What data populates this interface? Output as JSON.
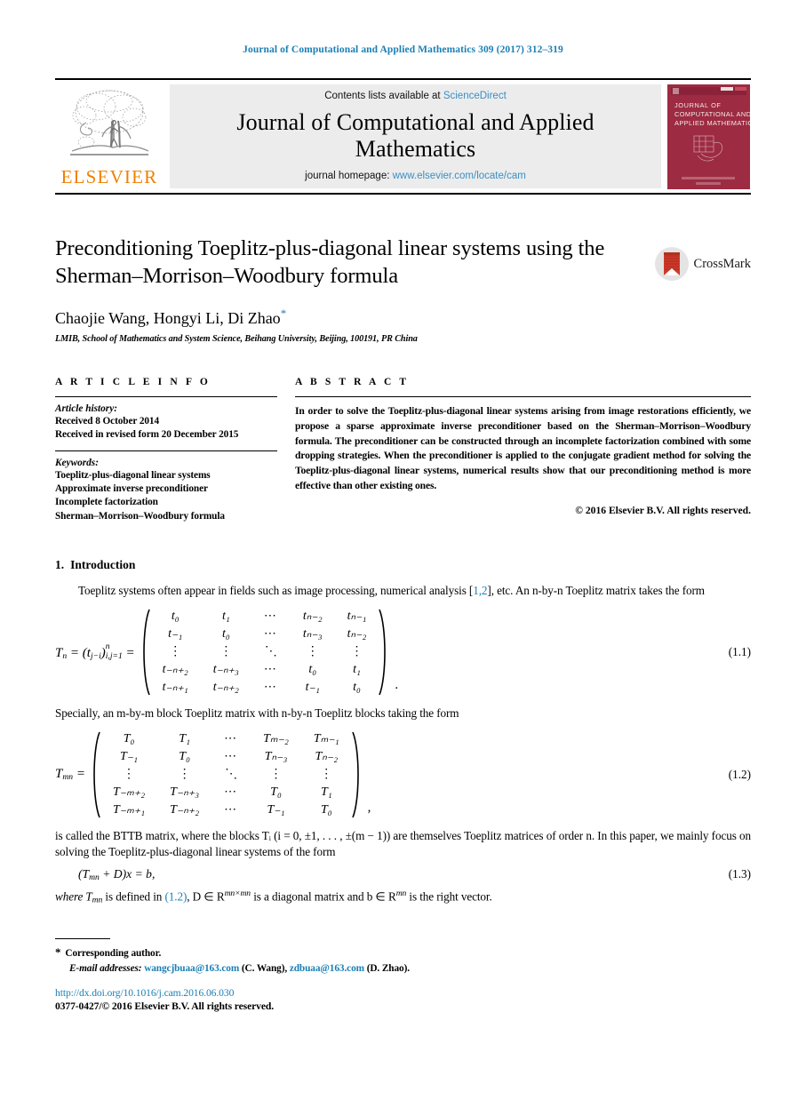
{
  "running_head": "Journal of Computational and Applied Mathematics 309 (2017) 312–319",
  "masthead": {
    "publisher_wordmark": "ELSEVIER",
    "contents_prefix": "Contents lists available at ",
    "contents_link": "ScienceDirect",
    "journal_name_line1": "Journal of Computational and Applied",
    "journal_name_line2": "Mathematics",
    "homepage_prefix": "journal homepage: ",
    "homepage_url": "www.elsevier.com/locate/cam",
    "cover_title_line1": "JOURNAL OF",
    "cover_title_line2": "COMPUTATIONAL AND",
    "cover_title_line3": "APPLIED MATHEMATICS",
    "cover_color": "#9d2b41"
  },
  "article": {
    "title": "Preconditioning Toeplitz-plus-diagonal linear systems using the Sherman–Morrison–Woodbury formula",
    "authors": "Chaojie Wang, Hongyi Li, Di Zhao",
    "corresponding_marker": "*",
    "affiliation": "LMIB, School of Mathematics and System Science, Beihang University, Beijing, 100191, PR China",
    "crossmark_label": "CrossMark"
  },
  "info": {
    "heading": "A R T I C L E    I N F O",
    "history_label": "Article history:",
    "history_lines": [
      "Received 8 October 2014",
      "Received in revised form 20 December 2015"
    ],
    "keywords_label": "Keywords:",
    "keywords": [
      "Toeplitz-plus-diagonal linear systems",
      "Approximate inverse preconditioner",
      "Incomplete factorization",
      "Sherman–Morrison–Woodbury formula"
    ]
  },
  "abstract": {
    "heading": "A B S T R A C T",
    "text": "In order to solve the Toeplitz-plus-diagonal linear systems arising from image restorations efficiently, we propose a sparse approximate inverse preconditioner based on the Sherman–Morrison–Woodbury formula. The preconditioner can be constructed through an incomplete factorization combined with some dropping strategies. When the preconditioner is applied to the conjugate gradient method for solving the Toeplitz-plus-diagonal linear systems, numerical results show that our preconditioning method is more effective than other existing ones.",
    "copyright": "© 2016 Elsevier B.V. All rights reserved."
  },
  "body": {
    "section_number": "1.",
    "section_title": "Introduction",
    "para1_before_ref": "Toeplitz systems often appear in fields such as image processing, numerical analysis [",
    "para1_ref": "1,2",
    "para1_after_ref": "], etc. An n-by-n Toeplitz matrix takes the form",
    "para2": "Specially, an m-by-m block Toeplitz matrix with n-by-n Toeplitz blocks taking the form",
    "para3": "is called the BTTB matrix, where the blocks Tᵢ (i = 0, ±1, . . . , ±(m − 1)) are themselves Toeplitz matrices of order n. In this paper, we mainly focus on solving the Toeplitz-plus-diagonal linear systems of the form",
    "para4_before_ref": "where T",
    "para4_sub": "mn",
    "para4_mid": " is defined in ",
    "para4_ref": "(1.2)",
    "para4_after": ", D ∈ R",
    "para4_sup1": "mn×mn",
    "para4_after2": " is a diagonal matrix and b ∈ R",
    "para4_sup2": "mn",
    "para4_end": " is the right vector."
  },
  "equations": {
    "eq11": {
      "number": "(1.1)",
      "lhs_T": "T",
      "lhs_sub": "n",
      "lhs_mid": " = (t",
      "lhs_jisub": "j−i",
      "lhs_close": ")",
      "lhs_supsub_top": "n",
      "lhs_supsub_bot": "i,j=1",
      "lhs_eq": " =",
      "trailing": ".",
      "rows": [
        [
          "t₀",
          "t₁",
          "⋯",
          "tₙ₋₂",
          "tₙ₋₁"
        ],
        [
          "t₋₁",
          "t₀",
          "⋯",
          "tₙ₋₃",
          "tₙ₋₂"
        ],
        [
          "⋮",
          "⋮",
          "⋱",
          "⋮",
          "⋮"
        ],
        [
          "t₋ₙ₊₂",
          "t₋ₙ₊₃",
          "⋯",
          "t₀",
          "t₁"
        ],
        [
          "t₋ₙ₊₁",
          "t₋ₙ₊₂",
          "⋯",
          "t₋₁",
          "t₀"
        ]
      ]
    },
    "eq12": {
      "number": "(1.2)",
      "lhs_T": "T",
      "lhs_sub": "mn",
      "lhs_eq": " =",
      "trailing": ",",
      "rows": [
        [
          "T₀",
          "T₁",
          "⋯",
          "Tₘ₋₂",
          "Tₘ₋₁"
        ],
        [
          "T₋₁",
          "T₀",
          "⋯",
          "Tₙ₋₃",
          "Tₙ₋₂"
        ],
        [
          "⋮",
          "⋮",
          "⋱",
          "⋮",
          "⋮"
        ],
        [
          "T₋ₘ₊₂",
          "T₋ₙ₊₃",
          "⋯",
          "T₀",
          "T₁"
        ],
        [
          "T₋ₘ₊₁",
          "T₋ₙ₊₂",
          "⋯",
          "T₋₁",
          "T₀"
        ]
      ]
    },
    "eq13": {
      "number": "(1.3)",
      "text": "(T",
      "sub": "mn",
      "text2": " + D)x = b,"
    }
  },
  "footnote": {
    "star": "*",
    "corresponding": "Corresponding author.",
    "email_label": "E-mail addresses:",
    "email1": "wangcjbuaa@163.com",
    "email1_name": "(C. Wang),",
    "email2": "zdbuaa@163.com",
    "email2_name": "(D. Zhao).",
    "doi": "http://dx.doi.org/10.1016/j.cam.2016.06.030",
    "issn": "0377-0427/© 2016 Elsevier B.V. All rights reserved."
  },
  "colors": {
    "link_blue": "#1a7fb5",
    "sciencedirect_blue": "#3a8fc4",
    "elsevier_orange": "#f08000",
    "cover_maroon": "#9d2b41"
  }
}
